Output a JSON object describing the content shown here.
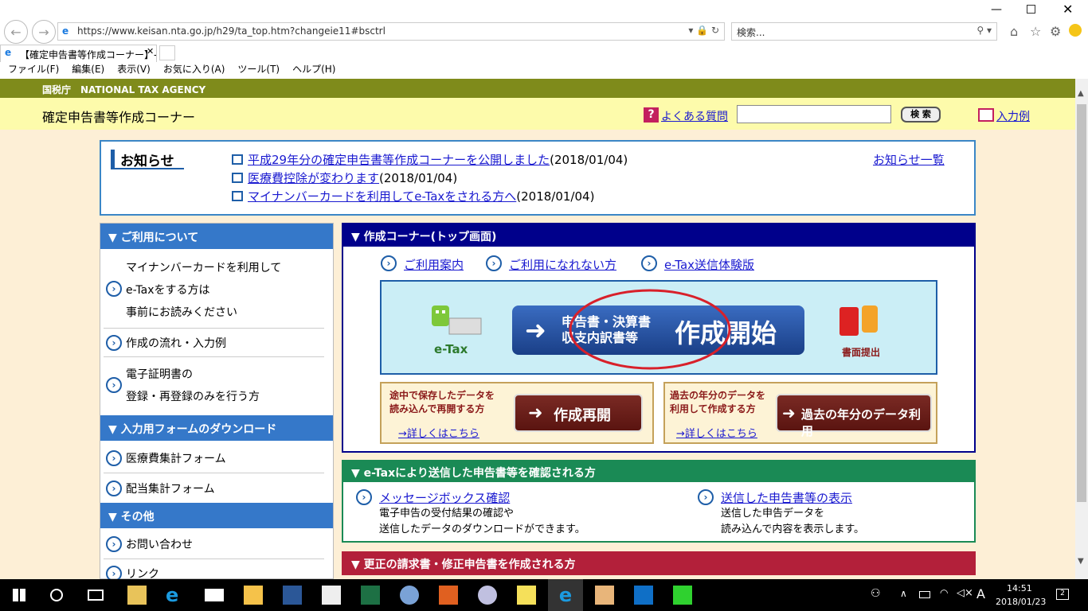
{
  "browser": {
    "url": "https://www.keisan.nta.go.jp/h29/ta_top.htm?changeie11#bsctrl",
    "search_placeholder": "検索...",
    "tab_title": "【確定申告書等作成コーナー】-...",
    "menu": [
      "ファイル(F)",
      "編集(E)",
      "表示(V)",
      "お気に入り(A)",
      "ツール(T)",
      "ヘルプ(H)"
    ]
  },
  "site": {
    "agency": "国税庁　NATIONAL TAX AGENCY",
    "title": "確定申告書等作成コーナー",
    "faq": "よくある質問",
    "search_btn": "検 索",
    "example": "入力例"
  },
  "news": {
    "heading": "お知らせ",
    "items": [
      {
        "link": "平成29年分の確定申告書等作成コーナーを公開しました",
        "date": "(2018/01/04)"
      },
      {
        "link": "医療費控除が変わります",
        "date": "(2018/01/04)"
      },
      {
        "link": "マイナンバーカードを利用してe-Taxをされる方へ",
        "date": "(2018/01/04)"
      }
    ],
    "list_link": "お知らせ一覧"
  },
  "left": {
    "h1": "▼ ご利用について",
    "i1a": "マイナンバーカードを利用して",
    "i1b": "e-Taxをする方は",
    "i1c": "事前にお読みください",
    "i2": "作成の流れ・入力例",
    "i3a": "電子証明書の",
    "i3b": "登録・再登録のみを行う方",
    "h2": "▼ 入力用フォームのダウンロード",
    "i4": "医療費集計フォーム",
    "i5": "配当集計フォーム",
    "h3": "▼ その他",
    "i6": "お問い合わせ",
    "i7": "リンク"
  },
  "main": {
    "heading": "▼ 作成コーナー(トップ画面)",
    "links": [
      "ご利用案内",
      "ご利用になれない方",
      "e-Tax送信体験版"
    ],
    "etax_label": "e-Tax",
    "start_line1": "申告書・決算書",
    "start_line2": "収支内訳書等",
    "start_big": "作成開始",
    "paper_label": "書面提出",
    "resume_label1": "途中で保存したデータを",
    "resume_label2": "読み込んで再開する方",
    "resume_more": "→詳しくはこちら",
    "resume_btn": "作成再開",
    "past_label1": "過去の年分のデータを",
    "past_label2": "利用して作成する方",
    "past_more": "→詳しくはこちら",
    "past_btn": "過去の年分のデータ利用"
  },
  "etax": {
    "heading": "▼ e-Taxにより送信した申告書等を確認される方",
    "msg_link": "メッセージボックス確認",
    "msg_t1": "電子申告の受付結果の確認や",
    "msg_t2": "送信したデータのダウンロードができます。",
    "sent_link": "送信した申告書等の表示",
    "sent_t1": "送信した申告データを",
    "sent_t2": "読み込んで内容を表示します。"
  },
  "correction": {
    "heading": "▼ 更正の請求書・修正申告書を作成される方"
  },
  "taskbar": {
    "time": "14:51",
    "date": "2018/01/23",
    "ime": "A",
    "notif": "2"
  },
  "colors": {
    "ntabar": "#7f8b1b",
    "yellow": "#fdfbab",
    "navy": "#00008b",
    "green": "#1a8a55",
    "red": "#b3203a",
    "blue": "#3578c9"
  }
}
